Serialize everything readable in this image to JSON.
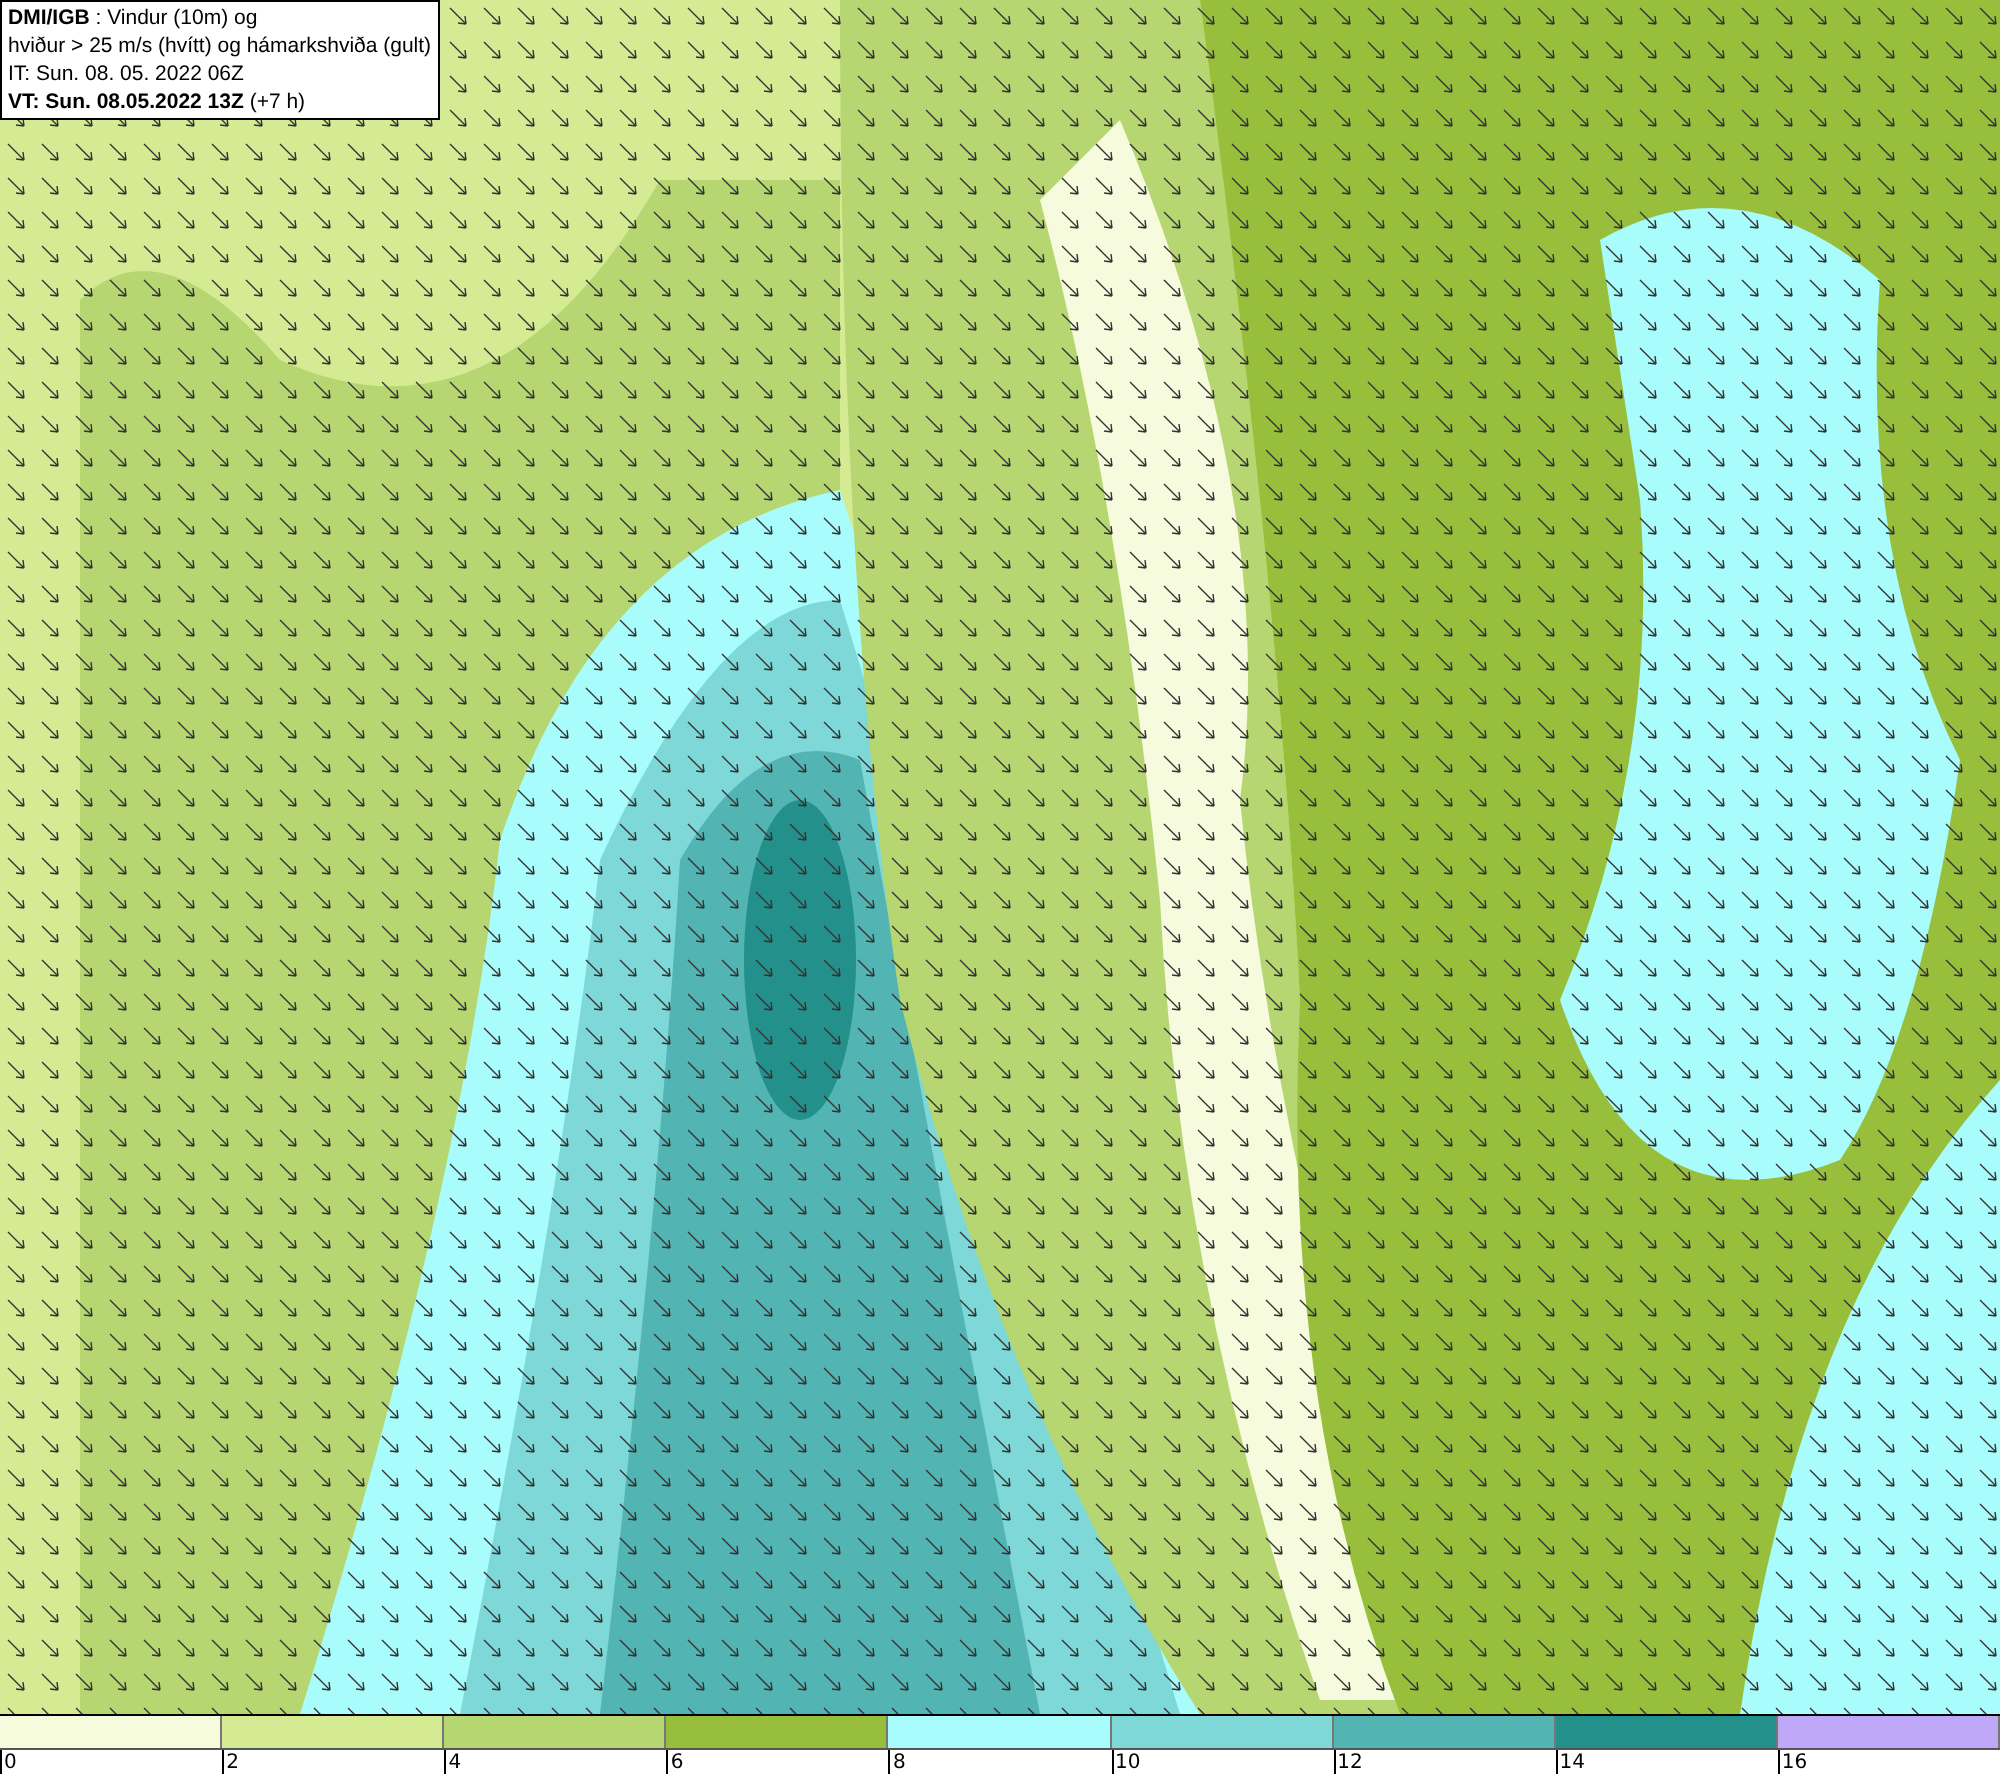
{
  "header": {
    "lines": [
      "**DMI/IGB** : Vindur (10m) og",
      "hviður > 25 m/s (hvítt) og hámarkshviða (gult)",
      "IT: Sun. 08. 05. 2022 06Z",
      "**VT: Sun. 08.05.2022 13Z** (+7 h)"
    ]
  },
  "legend": {
    "bins": [
      {
        "label": "0",
        "color": "#f5fbdc"
      },
      {
        "label": "2",
        "color": "#d4eb94"
      },
      {
        "label": "4",
        "color": "#b5d670"
      },
      {
        "label": "6",
        "color": "#98bf3c"
      },
      {
        "label": "8",
        "color": "#a8fcfc"
      },
      {
        "label": "10",
        "color": "#7ed8d8"
      },
      {
        "label": "12",
        "color": "#53b4b4"
      },
      {
        "label": "14",
        "color": "#23908c"
      },
      {
        "label": "16",
        "color": "#c0a8f8"
      }
    ]
  }
}
